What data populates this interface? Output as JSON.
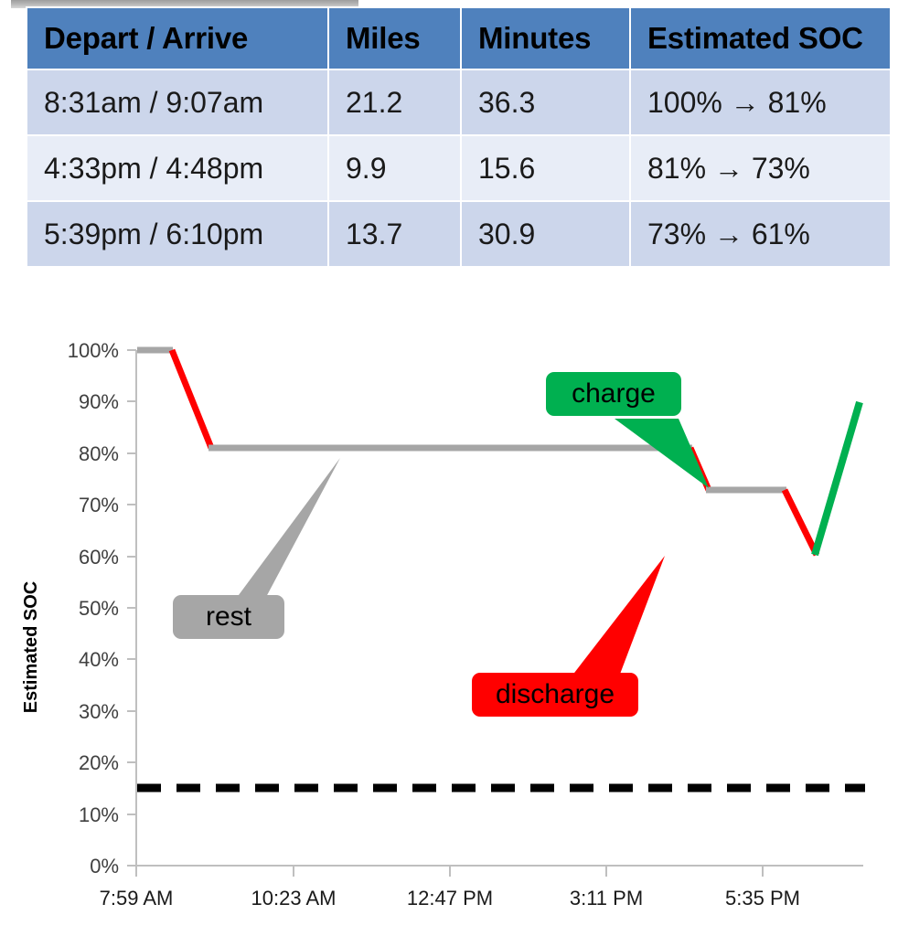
{
  "table": {
    "columns": [
      "Depart / Arrive",
      "Miles",
      "Minutes",
      "Estimated SOC"
    ],
    "rows": [
      {
        "route": "8:31am / 9:07am",
        "miles": "21.2",
        "minutes": "36.3",
        "soc": "100% → 81%"
      },
      {
        "route": "4:33pm / 4:48pm",
        "miles": "9.9",
        "minutes": "15.6",
        "soc": "81% → 73%"
      },
      {
        "route": "5:39pm / 6:10pm",
        "miles": "13.7",
        "minutes": "30.9",
        "soc": "73% → 61%"
      }
    ]
  },
  "chart_data": {
    "type": "line",
    "title": "",
    "xlabel": "",
    "ylabel": "Estimated SOC",
    "ylim": [
      0,
      100
    ],
    "ytick_labels": [
      "100%",
      "90%",
      "80%",
      "70%",
      "60%",
      "50%",
      "40%",
      "30%",
      "20%",
      "10%",
      "0%"
    ],
    "ytick_values": [
      100,
      90,
      80,
      70,
      60,
      50,
      40,
      30,
      20,
      10,
      0
    ],
    "xtick_labels": [
      "7:59 AM",
      "10:23 AM",
      "12:47 PM",
      "3:11 PM",
      "5:35 PM"
    ],
    "grid": false,
    "legend": "none",
    "reference_line": {
      "label": "",
      "value": 15,
      "style": "dashed",
      "color": "#000000"
    },
    "segments": [
      {
        "name": "rest",
        "color": "#a6a6a6",
        "from": {
          "x": "7:59 AM",
          "y": 100
        },
        "to": {
          "x": "8:31am",
          "y": 100
        }
      },
      {
        "name": "discharge",
        "color": "#ff0000",
        "from": {
          "x": "8:31am",
          "y": 100
        },
        "to": {
          "x": "9:07am",
          "y": 81
        }
      },
      {
        "name": "rest",
        "color": "#a6a6a6",
        "from": {
          "x": "9:07am",
          "y": 81
        },
        "to": {
          "x": "4:33pm",
          "y": 81
        }
      },
      {
        "name": "discharge",
        "color": "#ff0000",
        "from": {
          "x": "4:33pm",
          "y": 81
        },
        "to": {
          "x": "4:48pm",
          "y": 73
        }
      },
      {
        "name": "rest",
        "color": "#a6a6a6",
        "from": {
          "x": "4:48pm",
          "y": 73
        },
        "to": {
          "x": "5:39pm",
          "y": 73
        }
      },
      {
        "name": "discharge",
        "color": "#ff0000",
        "from": {
          "x": "5:39pm",
          "y": 73
        },
        "to": {
          "x": "6:10pm",
          "y": 61
        }
      },
      {
        "name": "charge",
        "color": "#00b050",
        "from": {
          "x": "6:10pm",
          "y": 61
        },
        "to": {
          "x": "7:20pm",
          "y": 90
        }
      }
    ],
    "callouts": [
      {
        "label": "rest",
        "color": "#a6a6a6",
        "text_color": "#000000"
      },
      {
        "label": "charge",
        "color": "#00b050",
        "text_color": "#000000"
      },
      {
        "label": "discharge",
        "color": "#ff0000",
        "text_color": "#000000"
      }
    ]
  },
  "colors": {
    "header_fill": "#4f81bd",
    "row_odd": "#ccd6eb",
    "row_even": "#e8edf7",
    "rest": "#a6a6a6",
    "discharge": "#ff0000",
    "charge": "#00b050",
    "reference": "#000000"
  }
}
